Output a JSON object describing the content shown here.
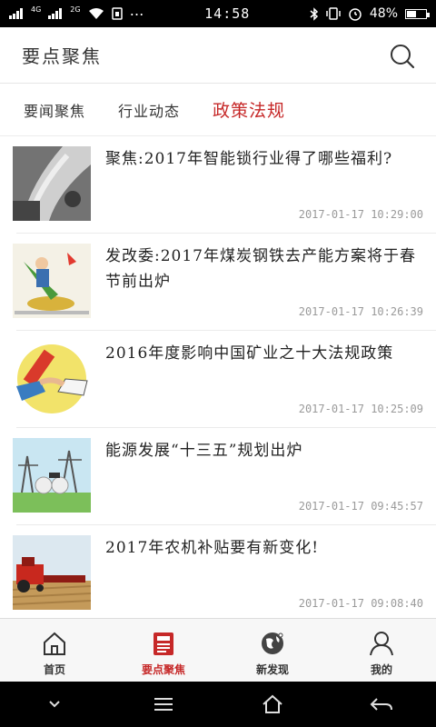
{
  "status_bar": {
    "network_1": "4G",
    "network_2": "2G",
    "time": "14:58",
    "battery": "48%",
    "battery_level": 0.48
  },
  "header": {
    "title": "要点聚焦",
    "search_icon": "search-icon"
  },
  "tabs": [
    {
      "label": "要闻聚焦",
      "active": false
    },
    {
      "label": "行业动态",
      "active": false
    },
    {
      "label": "政策法规",
      "active": true
    }
  ],
  "news": [
    {
      "title": "聚焦:2017年智能锁行业得了哪些福利?",
      "time": "2017-01-17 10:29:00"
    },
    {
      "title": "发改委:2017年煤炭钢铁去产能方案将于春节前出炉",
      "time": "2017-01-17 10:26:39"
    },
    {
      "title": "2016年度影响中国矿业之十大法规政策",
      "time": "2017-01-17 10:25:09"
    },
    {
      "title": "能源发展“十三五”规划出炉",
      "time": "2017-01-17 09:45:57"
    },
    {
      "title": "2017年农机补贴要有新变化!",
      "time": "2017-01-17 09:08:40"
    }
  ],
  "bottom_nav": [
    {
      "label": "首页",
      "icon": "home-icon",
      "active": false
    },
    {
      "label": "要点聚焦",
      "icon": "news-icon",
      "active": true
    },
    {
      "label": "新发现",
      "icon": "globe-icon",
      "active": false
    },
    {
      "label": "我的",
      "icon": "person-icon",
      "active": false
    }
  ],
  "colors": {
    "accent": "#c62828",
    "text": "#222222",
    "muted": "#9a9a9a"
  }
}
